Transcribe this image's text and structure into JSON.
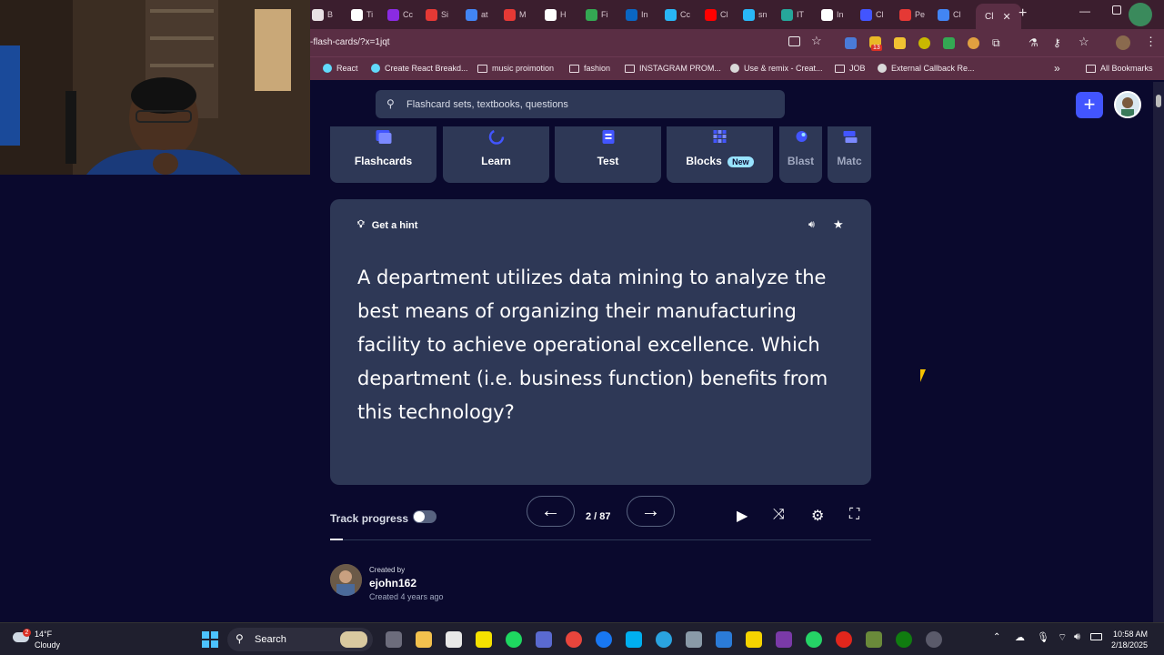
{
  "browser": {
    "tabs": [
      {
        "label": "B",
        "color": "#e8e0e4"
      },
      {
        "label": "Ti",
        "color": "#ffffff"
      },
      {
        "label": "Cc",
        "color": "#8a2be2"
      },
      {
        "label": "Si",
        "color": "#e53935"
      },
      {
        "label": "at",
        "color": "#4285f4"
      },
      {
        "label": "M",
        "color": "#e53935"
      },
      {
        "label": "H",
        "color": "#ffffff"
      },
      {
        "label": "Fi",
        "color": "#34a853"
      },
      {
        "label": "In",
        "color": "#0a66c2"
      },
      {
        "label": "Cc",
        "color": "#29b6f6"
      },
      {
        "label": "Cl",
        "color": "#ff0000"
      },
      {
        "label": "sn",
        "color": "#29b6f6"
      },
      {
        "label": "IT",
        "color": "#26a69a"
      },
      {
        "label": "In",
        "color": "#ffffff"
      },
      {
        "label": "Cl",
        "color": "#4255ff"
      },
      {
        "label": "Pe",
        "color": "#e53935"
      },
      {
        "label": "Cl",
        "color": "#4285f4"
      }
    ],
    "active_tab_label": "Cl",
    "url": "-flash-cards/?x=1jqt",
    "bookmarks": [
      {
        "label": "React",
        "icon": "react-icon"
      },
      {
        "label": "Create React Breakd...",
        "icon": "react-icon"
      },
      {
        "label": "music proimotion",
        "icon": "folder-icon"
      },
      {
        "label": "fashion",
        "icon": "folder-icon"
      },
      {
        "label": "INSTAGRAM PROM...",
        "icon": "folder-icon"
      },
      {
        "label": "Use & remix - Creat...",
        "icon": "remix-icon"
      },
      {
        "label": "JOB",
        "icon": "folder-icon"
      },
      {
        "label": "External Callback Re...",
        "icon": "globe-icon"
      }
    ],
    "all_bookmarks_label": "All Bookmarks",
    "extension_badge": "13"
  },
  "quizlet": {
    "search_placeholder": "Flashcard sets, textbooks, questions",
    "modes": [
      {
        "label": "Flashcards",
        "icon": "flashcards-icon"
      },
      {
        "label": "Learn",
        "icon": "learn-icon"
      },
      {
        "label": "Test",
        "icon": "test-icon"
      },
      {
        "label": "Blocks",
        "icon": "blocks-icon",
        "badge": "New"
      },
      {
        "label": "Blast",
        "icon": "blast-icon"
      },
      {
        "label": "Matc",
        "icon": "match-icon"
      }
    ],
    "card": {
      "hint_label": "Get a hint",
      "question": "A department utilizes data mining to analyze the best means of organizing their manufacturing facility to achieve operational excellence. Which department (i.e. business function) benefits from this technology?"
    },
    "controls": {
      "track_progress_label": "Track progress",
      "counter": "2 / 87",
      "progress_fraction": 0.023
    },
    "creator": {
      "created_by_label": "Created by",
      "username": "ejohn162",
      "created_ago": "Created 4 years ago"
    }
  },
  "taskbar": {
    "weather_temp": "14°F",
    "weather_desc": "Cloudy",
    "weather_badge": "2",
    "search_label": "Search",
    "time": "10:58 AM",
    "date": "2/18/2025"
  }
}
